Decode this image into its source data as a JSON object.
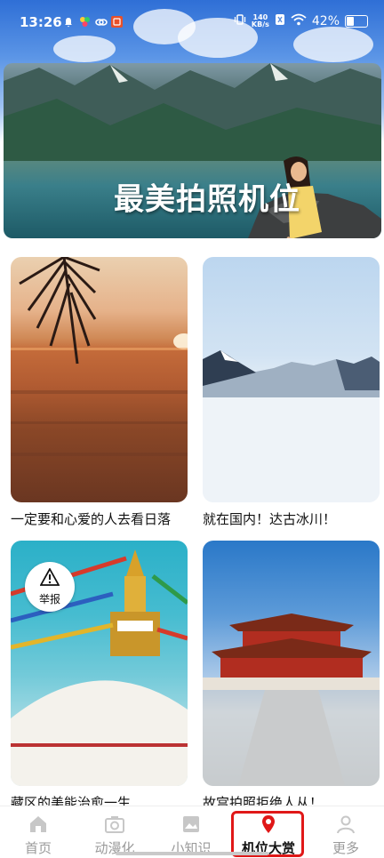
{
  "status_bar": {
    "time": "13:26",
    "net_speed_value": "140",
    "net_speed_unit": "KB/s",
    "battery_percent": "42%",
    "battery_level": 0.42
  },
  "hero": {
    "title": "最美拍照机位"
  },
  "cards": [
    {
      "caption": "一定要和心爱的人去看日落"
    },
    {
      "caption": "就在国内！达古冰川！"
    },
    {
      "caption": "藏区的美能治愈一生",
      "report_label": "举报"
    },
    {
      "caption": "故宫拍照拒绝人从！"
    }
  ],
  "bottom_nav": {
    "items": [
      {
        "label": "首页",
        "icon": "home-icon"
      },
      {
        "label": "动漫化",
        "icon": "camera-icon"
      },
      {
        "label": "小知识",
        "icon": "image-icon"
      },
      {
        "label": "机位大赏",
        "icon": "location-pin-icon",
        "active": true
      },
      {
        "label": "更多",
        "icon": "person-icon"
      }
    ]
  },
  "colors": {
    "accent_red": "#e01818",
    "nav_inactive": "#9a9a9a"
  }
}
